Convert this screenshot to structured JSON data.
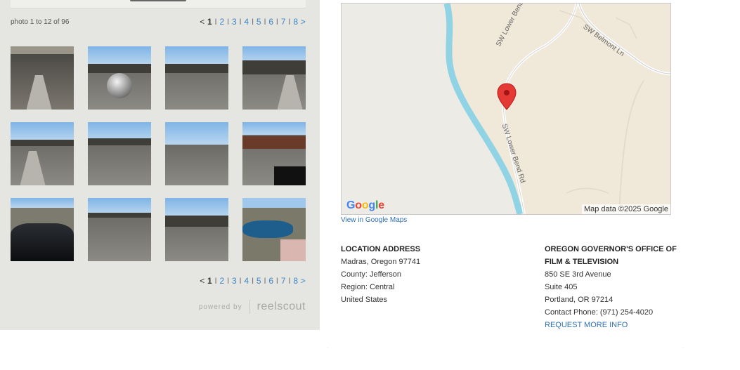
{
  "gallery": {
    "count_text": "photo 1 to 12 of 96",
    "pager": {
      "prev": "<",
      "current": "1",
      "pages": [
        "2",
        "3",
        "4",
        "5",
        "6",
        "7",
        "8"
      ],
      "next": ">"
    },
    "thumbnails": [
      {
        "name": "thumb-1"
      },
      {
        "name": "thumb-2"
      },
      {
        "name": "thumb-3"
      },
      {
        "name": "thumb-4"
      },
      {
        "name": "thumb-5"
      },
      {
        "name": "thumb-6"
      },
      {
        "name": "thumb-7"
      },
      {
        "name": "thumb-8"
      },
      {
        "name": "thumb-9"
      },
      {
        "name": "thumb-10"
      },
      {
        "name": "thumb-11"
      },
      {
        "name": "thumb-12"
      }
    ],
    "powered_by": "powered by",
    "brand": "reelscout"
  },
  "map": {
    "logo": "Google",
    "attribution": "Map data ©2025 Google",
    "streets": [
      "SW Lower Bend Rd",
      "SW Belmont Ln",
      "SW Lower Bend Rd"
    ],
    "view_link": "View in Google Maps",
    "colors": {
      "water": "#8fd3e4",
      "land": "#f0e8d9",
      "pin": "#e53935"
    }
  },
  "location": {
    "heading": "LOCATION ADDRESS",
    "lines": [
      "Madras, Oregon 97741",
      "County: Jefferson",
      "Region: Central",
      "United States"
    ]
  },
  "office": {
    "heading_line1": "OREGON GOVERNOR'S OFFICE OF",
    "heading_line2": "FILM & TELEVISION",
    "lines": [
      "850 SE 3rd Avenue",
      "Suite 405",
      "Portland, OR 97214",
      "Contact Phone: (971) 254-4020"
    ],
    "request_link": "REQUEST MORE INFO"
  }
}
